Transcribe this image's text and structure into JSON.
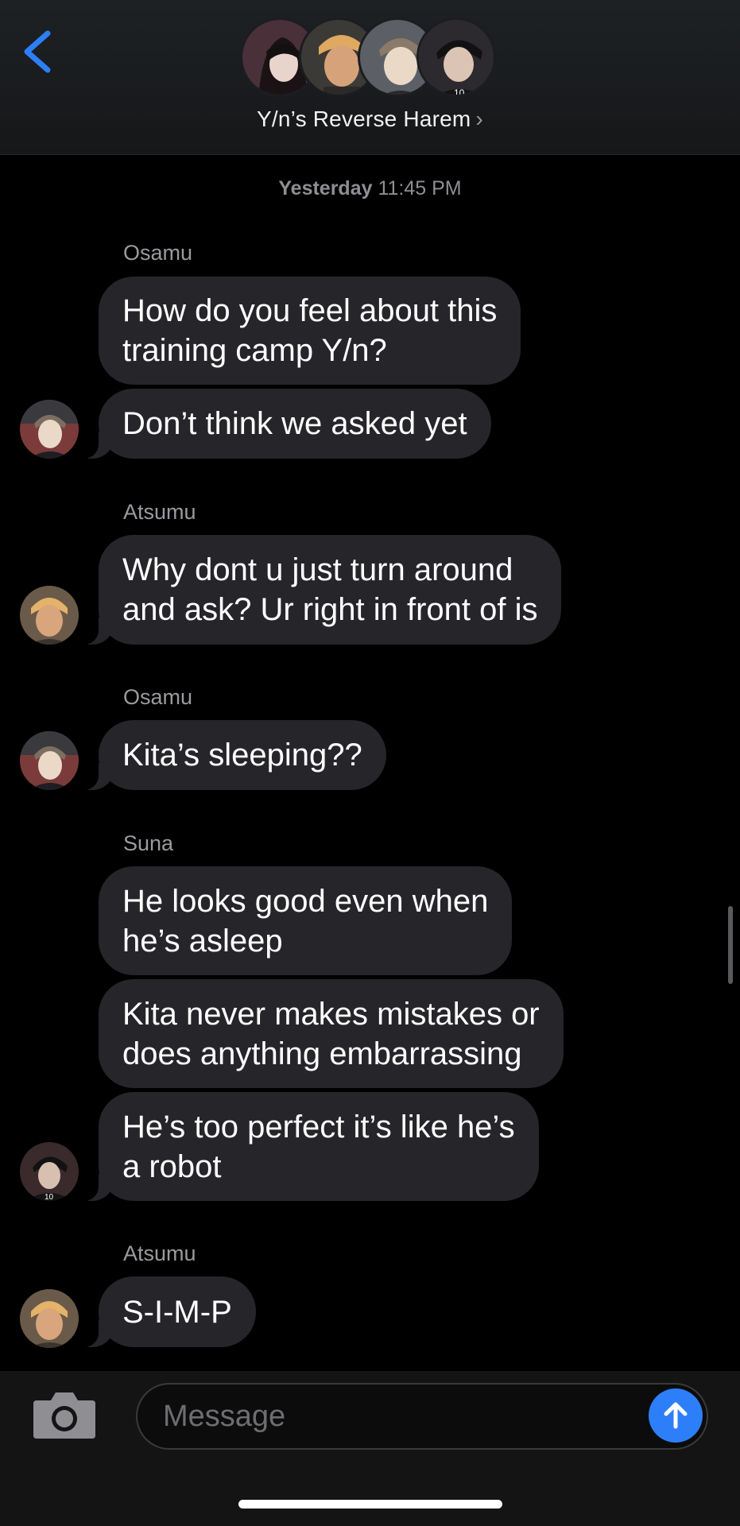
{
  "header": {
    "group_name": "Y/n’s Reverse Harem",
    "chevron": "›",
    "members": [
      "avatar-1",
      "avatar-2",
      "avatar-3",
      "avatar-4"
    ]
  },
  "timestamp": {
    "day": "Yesterday",
    "time": "11:45 PM"
  },
  "messages": [
    {
      "sender": "Osamu",
      "bubbles": [
        {
          "lines": [
            "How do you feel about this",
            "training camp Y/n?"
          ]
        },
        {
          "lines": [
            "Don’t think we asked yet"
          ]
        }
      ]
    },
    {
      "sender": "Atsumu",
      "bubbles": [
        {
          "lines": [
            "Why dont u just turn around",
            "and ask? Ur right in front of is"
          ]
        }
      ]
    },
    {
      "sender": "Osamu",
      "bubbles": [
        {
          "lines": [
            "Kita’s sleeping??"
          ]
        }
      ]
    },
    {
      "sender": "Suna",
      "bubbles": [
        {
          "lines": [
            "He looks good even when",
            "he’s asleep"
          ]
        },
        {
          "lines": [
            "Kita never makes mistakes or",
            "does anything embarrassing"
          ]
        },
        {
          "lines": [
            "He’s too perfect it’s like he’s",
            "a robot"
          ]
        }
      ]
    },
    {
      "sender": "Atsumu",
      "bubbles": [
        {
          "lines": [
            "S-I-M-P"
          ]
        }
      ]
    }
  ],
  "composer": {
    "placeholder": "Message"
  },
  "colors": {
    "accent": "#2d7ff9",
    "bubble": "#26252a",
    "background": "#000000"
  }
}
